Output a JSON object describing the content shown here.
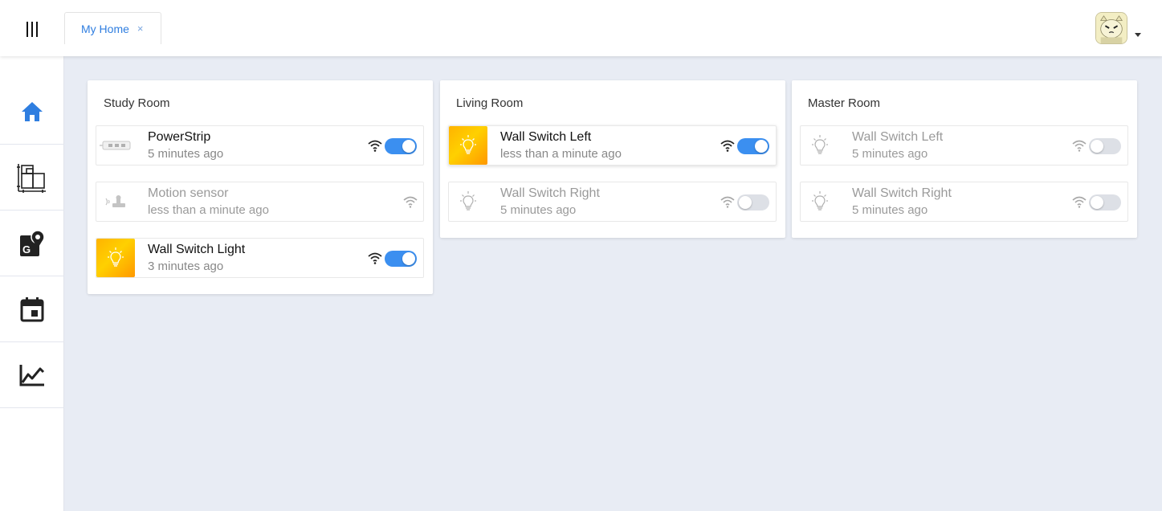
{
  "header": {
    "tab": {
      "label": "My Home",
      "close": "×"
    }
  },
  "sidebar": {
    "items": [
      {
        "icon": "home-icon",
        "active": true
      },
      {
        "icon": "floorplan-icon"
      },
      {
        "icon": "map-location-icon"
      },
      {
        "icon": "calendar-icon"
      },
      {
        "icon": "chart-line-icon"
      }
    ]
  },
  "colors": {
    "accent": "#3b8ff0",
    "on_tile": "#ffc107",
    "background": "#e8ecf4"
  },
  "rooms": [
    {
      "name": "Study Room",
      "devices": [
        {
          "name": "PowerStrip",
          "time": "5 minutes ago",
          "icon": "powerstrip-icon",
          "online": true,
          "on": true
        },
        {
          "name": "Motion sensor",
          "time": "less than a minute ago",
          "icon": "motion-sensor-icon",
          "online": false,
          "has_toggle": false
        },
        {
          "name": "Wall Switch Light",
          "time": "3 minutes ago",
          "icon": "bulb-icon",
          "online": true,
          "on": true
        }
      ]
    },
    {
      "name": "Living Room",
      "devices": [
        {
          "name": "Wall Switch Left",
          "time": "less than a minute ago",
          "icon": "bulb-icon",
          "online": true,
          "on": true
        },
        {
          "name": "Wall Switch Right",
          "time": "5 minutes ago",
          "icon": "bulb-icon",
          "online": false,
          "on": false
        }
      ]
    },
    {
      "name": "Master Room",
      "devices": [
        {
          "name": "Wall Switch Left",
          "time": "5 minutes ago",
          "icon": "bulb-icon",
          "online": false,
          "on": false
        },
        {
          "name": "Wall Switch Right",
          "time": "5 minutes ago",
          "icon": "bulb-icon",
          "online": false,
          "on": false
        }
      ]
    }
  ]
}
